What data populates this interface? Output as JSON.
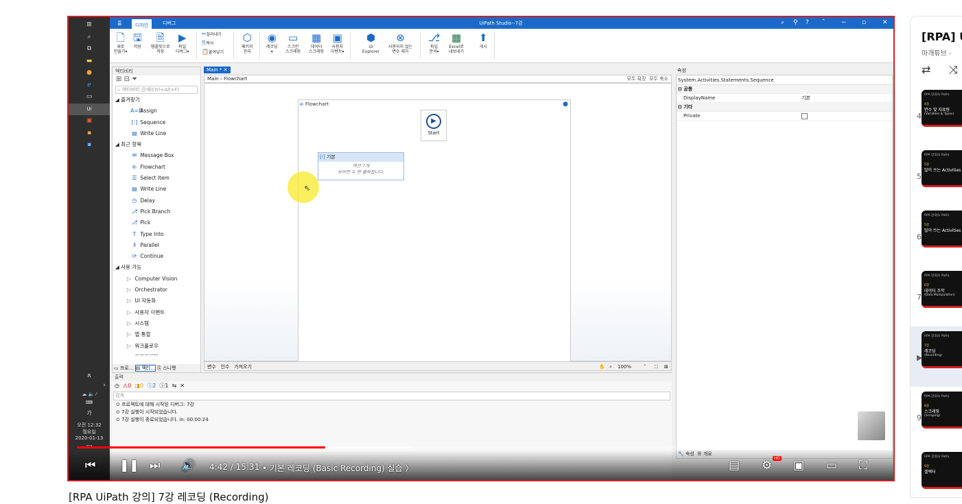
{
  "studio": {
    "tabs": [
      "홈",
      "디자인",
      "디버그"
    ],
    "window_title": "UiPath Studio--7강",
    "ribbon": [
      {
        "icon": "new-icon",
        "label": "새로\n만들기▾"
      },
      {
        "icon": "save-icon",
        "label": "저장"
      },
      {
        "icon": "save-template-icon",
        "label": "템플릿으로\n저장"
      },
      {
        "icon": "run-icon",
        "label": "파일\n디버그▾"
      },
      {
        "icon": "cut-icon",
        "label": "잘라내기"
      },
      {
        "icon": "copy-icon",
        "label": "복사"
      },
      {
        "icon": "paste-icon",
        "label": "붙여넣기"
      },
      {
        "icon": "package-icon",
        "label": "패키지\n관리"
      },
      {
        "icon": "record-icon",
        "label": "레코딩\n▾"
      },
      {
        "icon": "screen-scraping-icon",
        "label": "스크린\n스크래핑"
      },
      {
        "icon": "data-scraping-icon",
        "label": "데이터\n스크래핑"
      },
      {
        "icon": "user-event-icon",
        "label": "사용자\n이벤트▾"
      },
      {
        "icon": "ui-explorer-icon",
        "label": "UI\nExplorer"
      },
      {
        "icon": "remove-vars-icon",
        "label": "사용되지 않는\n변수 제거"
      },
      {
        "icon": "analyze-icon",
        "label": "파일\n분석▾"
      },
      {
        "icon": "excel-icon",
        "label": "Excel로\n내보내기"
      },
      {
        "icon": "publish-icon",
        "label": "게시"
      }
    ],
    "activities": {
      "title": "액티비티",
      "search_placeholder": "액티비티 검색(Ctrl+Alt+F)",
      "groups": [
        {
          "label": "즐겨찾기",
          "items": [
            "Assign",
            "Sequence",
            "Write Line"
          ]
        },
        {
          "label": "최근 항목",
          "items": [
            "Message Box",
            "Flowchart",
            "Select Item",
            "Write Line",
            "Delay",
            "Pick Branch",
            "Pick",
            "Type Into",
            "Parallel",
            "Continue"
          ]
        },
        {
          "label": "사용 가능",
          "items": [
            "Computer Vision",
            "Orchestrator",
            "UI 자동화",
            "사용자 이벤트",
            "시스템",
            "앱 통합",
            "워크플로우",
            "프로그래밍"
          ]
        }
      ],
      "bottom_tabs": [
        "프로...",
        "액티...",
        "스니펫"
      ]
    },
    "designer": {
      "tab": "Main *",
      "breadcrumb": [
        "Main",
        "Flowchart"
      ],
      "expand_all": "모두 확장",
      "collapse_all": "모두 축소",
      "flowchart_title": "Flowchart",
      "start_label": "Start",
      "sequence_title": "기본",
      "sequence_line1": "액션 7개",
      "sequence_line2": "보려면 두 번 클릭합니다.",
      "bottom_tabs": [
        "변수",
        "인수",
        "가져오기"
      ],
      "zoom": "100%"
    },
    "properties": {
      "title": "속성",
      "type_name": "System.Activities.Statements.Sequence",
      "sections": [
        {
          "label": "공통",
          "rows": [
            {
              "name": "DisplayName",
              "value": "기본"
            }
          ]
        },
        {
          "label": "기타",
          "rows": [
            {
              "name": "Private",
              "value": ""
            }
          ]
        }
      ],
      "bottom_tabs": [
        "속성",
        "개요"
      ]
    },
    "output": {
      "title": "출력",
      "counts": [
        "0",
        "0",
        "2",
        "1"
      ],
      "search_placeholder": "검색",
      "lines": [
        "프로젝트에 대해 시작된 디버그: 7강",
        "7강 실행이 시작되었습니다.",
        "7강 실행이 종료되었습니다. in: 00:00:24"
      ]
    },
    "taskbar": {
      "time": "오전 12:32",
      "day": "월요일",
      "date": "2020-01-13",
      "ime": "가"
    }
  },
  "player": {
    "time": "4:42 / 15:31",
    "chapter": "• 기본 레코딩 (Basic Recording) 실습 〉",
    "progress": 0.307,
    "buffered": 0.413
  },
  "video_title": "[RPA UiPath 강의] 7강 레코딩 (Recording)",
  "playlist": {
    "title": "[RPA] U",
    "owner": "마개튜브 -",
    "items": [
      {
        "num": "4",
        "series": "RPA 강의(U Path)",
        "line": "4강",
        "title": "변수 및 자료형",
        "sub": "(Variables & Types)"
      },
      {
        "num": "5",
        "series": "RPA 강의(U Path)",
        "line": "5강",
        "title": "많이 쓰는 Activities",
        "sub": ""
      },
      {
        "num": "6",
        "series": "RPA 강의(U Path)",
        "line": "5강",
        "title": "많이 쓰는 Activities",
        "sub": ""
      },
      {
        "num": "7",
        "series": "RPA 강의(U Path)",
        "line": "6강",
        "title": "데이터 조작",
        "sub": "(Data Manipulation)"
      },
      {
        "num": "▶",
        "series": "RPA 강의(U Path)",
        "line": "7강",
        "title": "레코딩",
        "sub": "(Recording)"
      },
      {
        "num": "9",
        "series": "RPA 강의(U Path)",
        "line": "8강",
        "title": "스크래핑",
        "sub": "(Scraping)"
      },
      {
        "num": "10",
        "series": "RPA 강의(U Path)",
        "line": "9강",
        "title": "셀렉터",
        "sub": ""
      }
    ]
  },
  "colors": {
    "accent": "#1b6ac9",
    "youtube_red": "#ff0000",
    "highlight": "#f7ea2a"
  }
}
